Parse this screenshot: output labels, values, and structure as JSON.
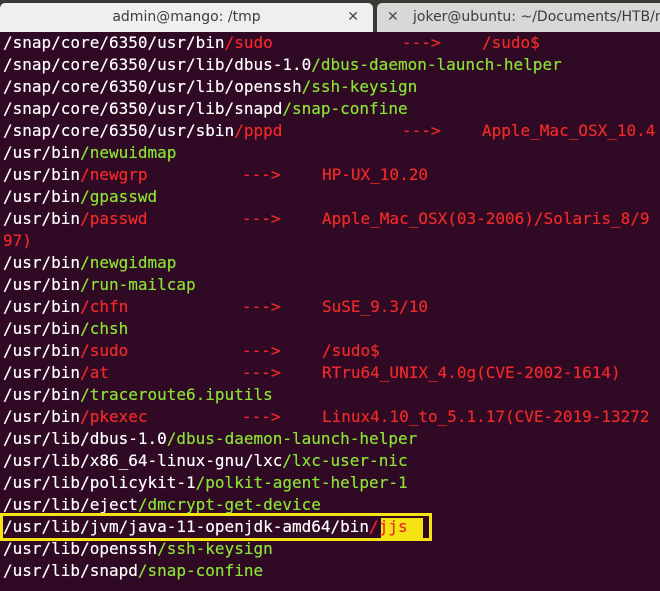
{
  "tabs": [
    {
      "title": "admin@mango: /tmp",
      "close": "✕",
      "active": true
    },
    {
      "title": "joker@ubuntu: ~/Documents/HTB/m",
      "close": "✕",
      "active": false
    }
  ],
  "lines": [
    {
      "path": "/snap/core/6350/usr/bin",
      "bin": "/sudo",
      "bin_color": "red",
      "arrow": "--->",
      "hint": "/sudo$"
    },
    {
      "path": "/snap/core/6350/usr/lib/dbus-1.0",
      "bin": "/dbus-daemon-launch-helper",
      "bin_color": "green",
      "arrow": "",
      "hint": ""
    },
    {
      "path": "/snap/core/6350/usr/lib/openssh",
      "bin": "/ssh-keysign",
      "bin_color": "green",
      "arrow": "",
      "hint": ""
    },
    {
      "path": "/snap/core/6350/usr/lib/snapd",
      "bin": "/snap-confine",
      "bin_color": "green",
      "arrow": "",
      "hint": ""
    },
    {
      "path": "/snap/core/6350/usr/sbin",
      "bin": "/pppd",
      "bin_color": "red",
      "arrow": "--->",
      "hint": "Apple_Mac_OSX_10.4"
    },
    {
      "path": "/usr/bin",
      "bin": "/newuidmap",
      "bin_color": "green",
      "arrow": "",
      "hint": ""
    },
    {
      "path": "/usr/bin",
      "bin": "/newgrp",
      "bin_color": "red",
      "arrow": "--->",
      "hint": "HP-UX_10.20"
    },
    {
      "path": "/usr/bin",
      "bin": "/gpasswd",
      "bin_color": "green",
      "arrow": "",
      "hint": ""
    },
    {
      "path": "/usr/bin",
      "bin": "/passwd",
      "bin_color": "red",
      "arrow": "--->",
      "hint": "Apple_Mac_OSX(03-2006)/Solaris_8/9"
    },
    {
      "path": "",
      "bin": "",
      "bin_color": "red",
      "arrow": "",
      "hint": "97)"
    },
    {
      "path": "/usr/bin",
      "bin": "/newgidmap",
      "bin_color": "green",
      "arrow": "",
      "hint": ""
    },
    {
      "path": "/usr/bin",
      "bin": "/run-mailcap",
      "bin_color": "green",
      "arrow": "",
      "hint": ""
    },
    {
      "path": "/usr/bin",
      "bin": "/chfn",
      "bin_color": "red",
      "arrow": "--->",
      "hint": "SuSE_9.3/10"
    },
    {
      "path": "/usr/bin",
      "bin": "/chsh",
      "bin_color": "green",
      "arrow": "",
      "hint": ""
    },
    {
      "path": "/usr/bin",
      "bin": "/sudo",
      "bin_color": "red",
      "arrow": "--->",
      "hint": "/sudo$"
    },
    {
      "path": "/usr/bin",
      "bin": "/at",
      "bin_color": "red",
      "arrow": "--->",
      "hint": "RTru64_UNIX_4.0g(CVE-2002-1614)"
    },
    {
      "path": "/usr/bin",
      "bin": "/traceroute6.iputils",
      "bin_color": "green",
      "arrow": "",
      "hint": ""
    },
    {
      "path": "/usr/bin",
      "bin": "/pkexec",
      "bin_color": "red",
      "arrow": "--->",
      "hint": "Linux4.10_to_5.1.17(CVE-2019-13272"
    },
    {
      "path": "/usr/lib/dbus-1.0",
      "bin": "/dbus-daemon-launch-helper",
      "bin_color": "green",
      "arrow": "",
      "hint": ""
    },
    {
      "path": "/usr/lib/x86_64-linux-gnu/lxc",
      "bin": "/lxc-user-nic",
      "bin_color": "green",
      "arrow": "",
      "hint": ""
    },
    {
      "path": "/usr/lib/policykit-1",
      "bin": "/polkit-agent-helper-1",
      "bin_color": "green",
      "arrow": "",
      "hint": ""
    },
    {
      "path": "/usr/lib/eject",
      "bin": "/dmcrypt-get-device",
      "bin_color": "green",
      "arrow": "",
      "hint": ""
    },
    {
      "path": "/usr/lib/jvm/java-11-openjdk-amd64/bin",
      "bin": "/jjs",
      "bin_color": "red",
      "arrow": "",
      "hint": "",
      "highlighted": true
    },
    {
      "path": "/usr/lib/openssh",
      "bin": "/ssh-keysign",
      "bin_color": "green",
      "arrow": "",
      "hint": ""
    },
    {
      "path": "/usr/lib/snapd",
      "bin": "/snap-confine",
      "bin_color": "green",
      "arrow": "",
      "hint": ""
    }
  ],
  "colors": {
    "background": "#300a24",
    "path": "#ffffff",
    "bin_green": "#8ae234",
    "bin_red": "#ef2929",
    "highlight": "#f5e414"
  }
}
